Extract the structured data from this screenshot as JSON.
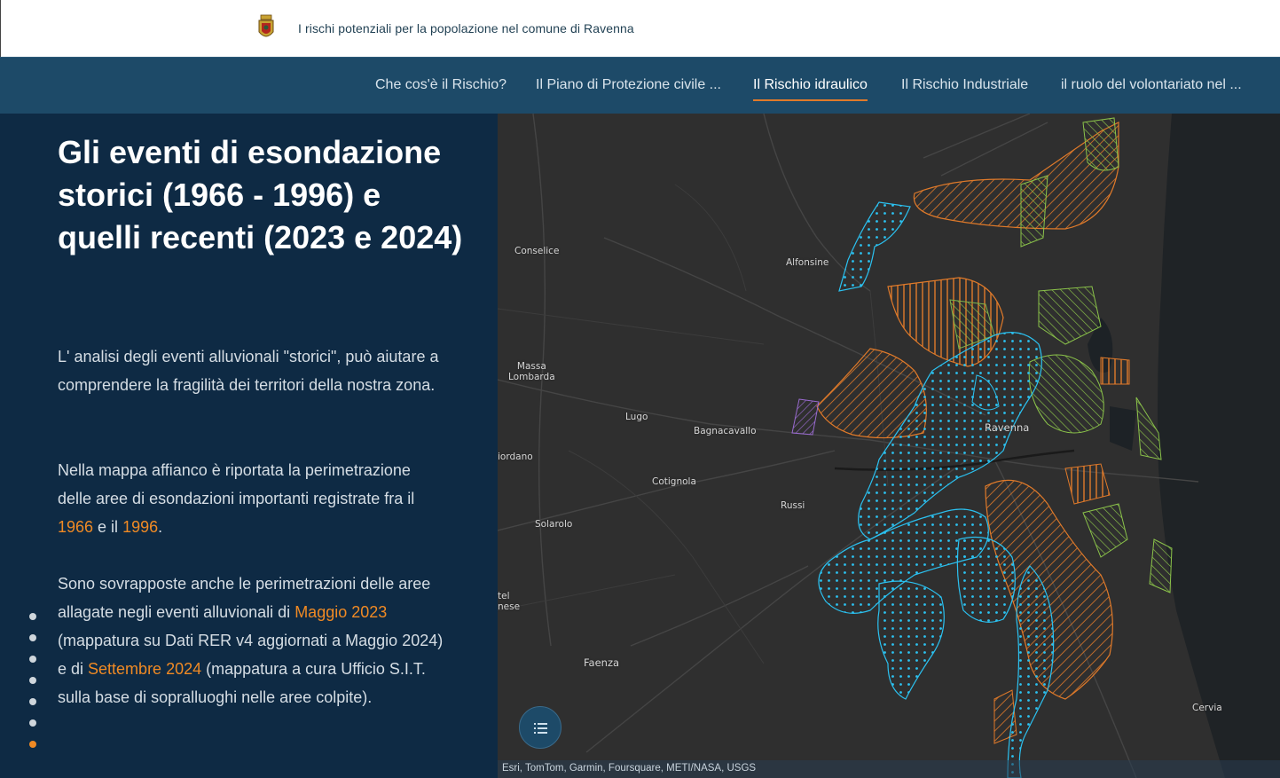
{
  "header": {
    "site_title": "I rischi potenziali per la popolazione nel comune di Ravenna",
    "logo_icon": "ravenna-coat-of-arms-icon"
  },
  "nav": {
    "items": [
      {
        "label": "Che cos'è il Rischio?",
        "active": false
      },
      {
        "label": "Il Piano di Protezione civile ...",
        "active": false
      },
      {
        "label": "Il Rischio idraulico",
        "active": true
      },
      {
        "label": "Il Rischio Industriale",
        "active": false
      },
      {
        "label": "il ruolo del volontariato nel ...",
        "active": false
      }
    ],
    "accent_color": "#e07a2a"
  },
  "content": {
    "heading": "Gli eventi di esondazione storici (1966 - 1996) e quelli recenti (2023 e 2024)",
    "p1": "L' analisi degli eventi alluvionali \"storici\", può aiutare a comprendere la fragilità dei territori della nostra zona.",
    "p2_a": "Nella mappa affianco è riportata la perimetrazione delle aree di esondazioni importanti registrate fra il ",
    "p2_year1": "1966",
    "p2_b": " e il ",
    "p2_year2": "1996",
    "p2_c": ".",
    "p3_a": "Sono sovrapposte anche le perimetrazioni delle aree allagate negli eventi alluvionali di ",
    "p3_event1": "Maggio 2023",
    "p3_b": " (mappatura su Dati RER v4 aggiornati a Maggio 2024) e di ",
    "p3_event2": "Settembre 2024",
    "p3_c": " (mappatura a cura Ufficio S.I.T. sulla base di sopralluoghi nelle aree colpite).",
    "highlight_color": "#f08a24"
  },
  "progress": {
    "total": 7,
    "current": 7
  },
  "map": {
    "places": {
      "conselice": "Conselice",
      "alfonsine": "Alfonsine",
      "massa_lombarda": "Massa\nLombarda",
      "lugo": "Lugo",
      "bagnacavallo": "Bagnacavallo",
      "ravenna": "Ravenna",
      "fordano": "iordano",
      "cotignola": "Cotignola",
      "russi": "Russi",
      "solarolo": "Solarolo",
      "castel": "tel\nnese",
      "faenza": "Faenza",
      "cervia": "Cervia"
    },
    "legend_icon": "list-icon",
    "attribution": "Esri, TomTom, Garmin, Foursquare, METI/NASA, USGS",
    "colors": {
      "flood_historic": "#e07a2a",
      "flood_2023": "#2bc1f0",
      "flood_2024": "#8bc34a",
      "sea": "#1f2326",
      "land": "#2f2f2f"
    }
  }
}
